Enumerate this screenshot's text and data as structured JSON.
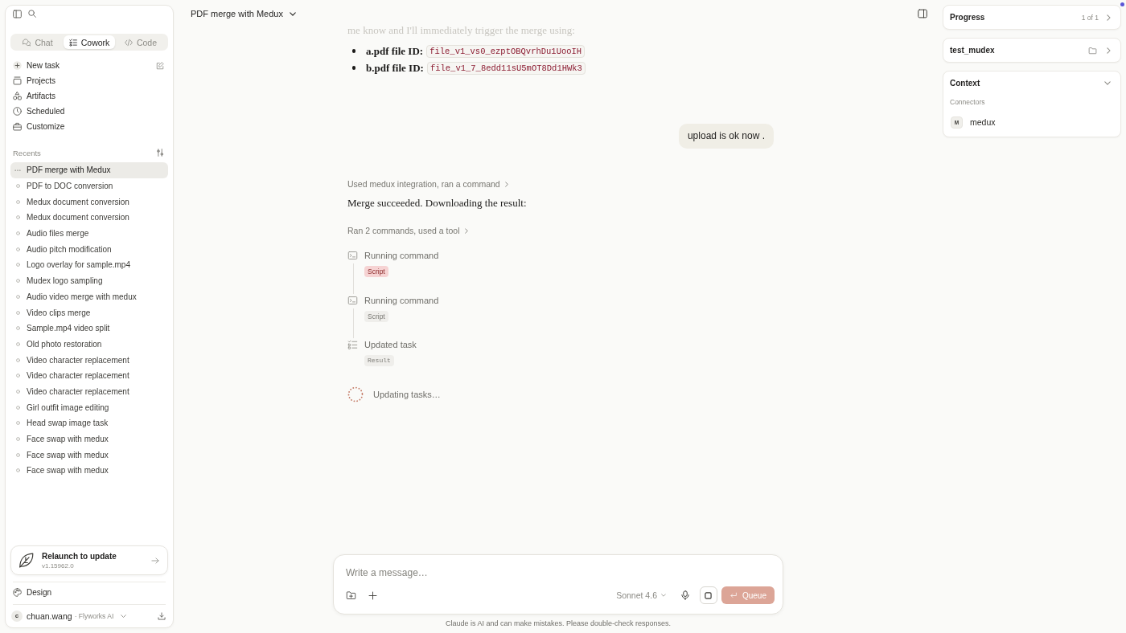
{
  "sidebar": {
    "tabs": [
      {
        "label": "Chat",
        "kind": "chat",
        "selected": false
      },
      {
        "label": "Cowork",
        "kind": "cowork",
        "selected": true
      },
      {
        "label": "Code",
        "kind": "code",
        "selected": false
      }
    ],
    "nav": [
      {
        "label": "New task",
        "kind": "new"
      },
      {
        "label": "Projects",
        "kind": "projects"
      },
      {
        "label": "Artifacts",
        "kind": "artifacts"
      },
      {
        "label": "Scheduled",
        "kind": "scheduled"
      },
      {
        "label": "Customize",
        "kind": "customize"
      }
    ],
    "recents_title": "Recents",
    "recents": [
      {
        "label": "PDF merge with Medux",
        "selected": true
      },
      {
        "label": "PDF to DOC conversion",
        "selected": false
      },
      {
        "label": "Medux document conversion",
        "selected": false
      },
      {
        "label": "Medux document conversion",
        "selected": false
      },
      {
        "label": "Audio files merge",
        "selected": false
      },
      {
        "label": "Audio pitch modification",
        "selected": false
      },
      {
        "label": "Logo overlay for sample.mp4",
        "selected": false
      },
      {
        "label": "Mudex logo sampling",
        "selected": false
      },
      {
        "label": "Audio video merge with medux",
        "selected": false
      },
      {
        "label": "Video clips merge",
        "selected": false
      },
      {
        "label": "Sample.mp4 video split",
        "selected": false
      },
      {
        "label": "Old photo restoration",
        "selected": false
      },
      {
        "label": "Video character replacement",
        "selected": false
      },
      {
        "label": "Video character replacement",
        "selected": false
      },
      {
        "label": "Video character replacement",
        "selected": false
      },
      {
        "label": "Girl outfit image editing",
        "selected": false
      },
      {
        "label": "Head swap image task",
        "selected": false
      },
      {
        "label": "Face swap with medux",
        "selected": false
      },
      {
        "label": "Face swap with medux",
        "selected": false
      },
      {
        "label": "Face swap with medux",
        "selected": false
      }
    ],
    "update": {
      "title": "Relaunch to update",
      "version": "v1.15962.0"
    },
    "settings_item": "Design",
    "account": {
      "initial": "c",
      "name": "chuan.wang",
      "org": "· Flyworks AI"
    }
  },
  "header": {
    "title": "PDF merge with Medux"
  },
  "thread": {
    "faded_text": "me know and I'll immediately trigger the merge using:",
    "file_ids": [
      {
        "label": "a.pdf file ID:",
        "code": "file_v1_vs0_ezptOBQvrhDu1UooIH"
      },
      {
        "label": "b.pdf file ID:",
        "code": "file_v1_7_8edd11sU5mOT8Dd1HWk3"
      }
    ],
    "user_message": "upload is ok now .",
    "tool_summary": "Used medux integration, ran a command",
    "reply": "Merge succeeded. Downloading the result:",
    "steps_summary": "Ran 2 commands, used a tool",
    "steps": [
      {
        "kind": "command",
        "title": "Running command",
        "badge": "Script",
        "highlighted": true
      },
      {
        "kind": "command",
        "title": "Running command",
        "badge": "Script",
        "highlighted": false
      },
      {
        "kind": "task",
        "title": "Updated task",
        "badge": "Result",
        "highlighted": false
      }
    ],
    "status": "Updating tasks…"
  },
  "composer": {
    "placeholder": "Write a message…",
    "model": "Sonnet 4.6",
    "queue_button": {
      "label": "Queue",
      "disabled": true
    }
  },
  "disclaimer": "Claude is AI and can make mistakes. Please double-check responses.",
  "panel": {
    "progress": {
      "title": "Progress",
      "count": "1 of 1"
    },
    "project": {
      "name": "test_mudex"
    },
    "context": {
      "title": "Context",
      "expanded": true,
      "section": "Connectors",
      "connectors": [
        {
          "initial": "M",
          "name": "medux"
        }
      ]
    }
  }
}
